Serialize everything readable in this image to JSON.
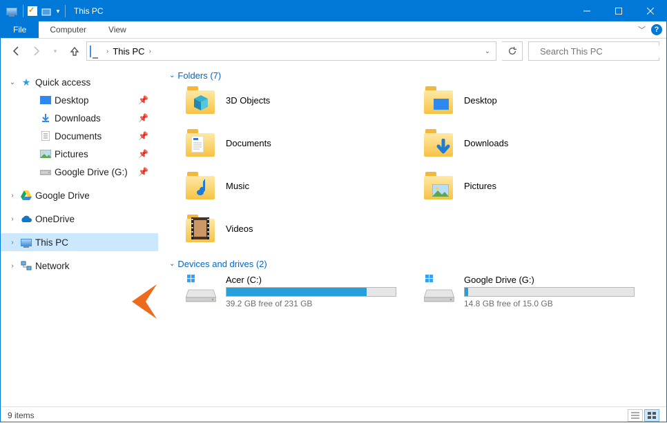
{
  "window": {
    "title": "This PC"
  },
  "tabs": {
    "file": "File",
    "items": [
      "Computer",
      "View"
    ]
  },
  "nav": {
    "crumb": "This PC",
    "search_placeholder": "Search This PC"
  },
  "tree": {
    "quick_access": {
      "label": "Quick access",
      "items": [
        {
          "label": "Desktop",
          "icon": "desktop"
        },
        {
          "label": "Downloads",
          "icon": "downloads"
        },
        {
          "label": "Documents",
          "icon": "documents"
        },
        {
          "label": "Pictures",
          "icon": "pictures"
        },
        {
          "label": "Google Drive (G:)",
          "icon": "drive"
        }
      ]
    },
    "roots": [
      {
        "label": "Google Drive",
        "icon": "gdrive"
      },
      {
        "label": "OneDrive",
        "icon": "onedrive"
      },
      {
        "label": "This PC",
        "icon": "pc",
        "selected": true
      },
      {
        "label": "Network",
        "icon": "network"
      }
    ]
  },
  "groups": {
    "folders": {
      "header": "Folders (7)",
      "items": [
        {
          "label": "3D Objects",
          "overlay": "cube"
        },
        {
          "label": "Desktop",
          "overlay": "desktop"
        },
        {
          "label": "Documents",
          "overlay": "doc"
        },
        {
          "label": "Downloads",
          "overlay": "down"
        },
        {
          "label": "Music",
          "overlay": "music"
        },
        {
          "label": "Pictures",
          "overlay": "pic"
        },
        {
          "label": "Videos",
          "overlay": "video"
        }
      ]
    },
    "drives": {
      "header": "Devices and drives (2)",
      "items": [
        {
          "name": "Acer (C:)",
          "free_text": "39.2 GB free of 231 GB",
          "fill_pct": 83,
          "kind": "local"
        },
        {
          "name": "Google Drive (G:)",
          "free_text": "14.8 GB free of 15.0 GB",
          "fill_pct": 2,
          "kind": "local"
        }
      ]
    }
  },
  "status": {
    "text": "9 items"
  }
}
